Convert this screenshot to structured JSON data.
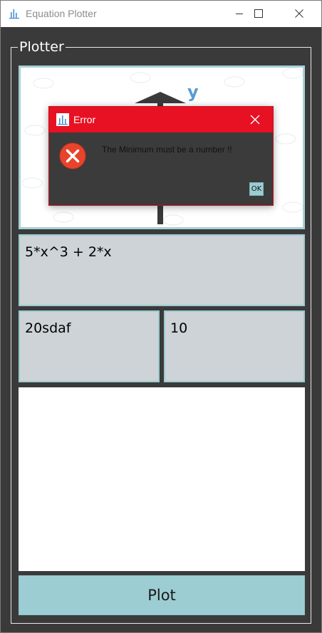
{
  "window": {
    "title": "Equation Plotter",
    "app_icon": "bar-chart-icon"
  },
  "group": {
    "title": "Plotter"
  },
  "equation_image": {
    "axis_letter": "y"
  },
  "fields": {
    "expression": "5*x^3 + 2*x",
    "minimum": "20sdaf",
    "maximum": "10"
  },
  "plot_button": {
    "label": "Plot"
  },
  "dialog": {
    "title": "Error",
    "message": "The Minimum must be a number !!",
    "ok_label": "OK",
    "icon": "error-icon"
  },
  "colors": {
    "window_bg": "#3a3a3a",
    "field_bg": "#cdd3d7",
    "accent": "#9ccdd3",
    "error_red": "#e81123"
  }
}
